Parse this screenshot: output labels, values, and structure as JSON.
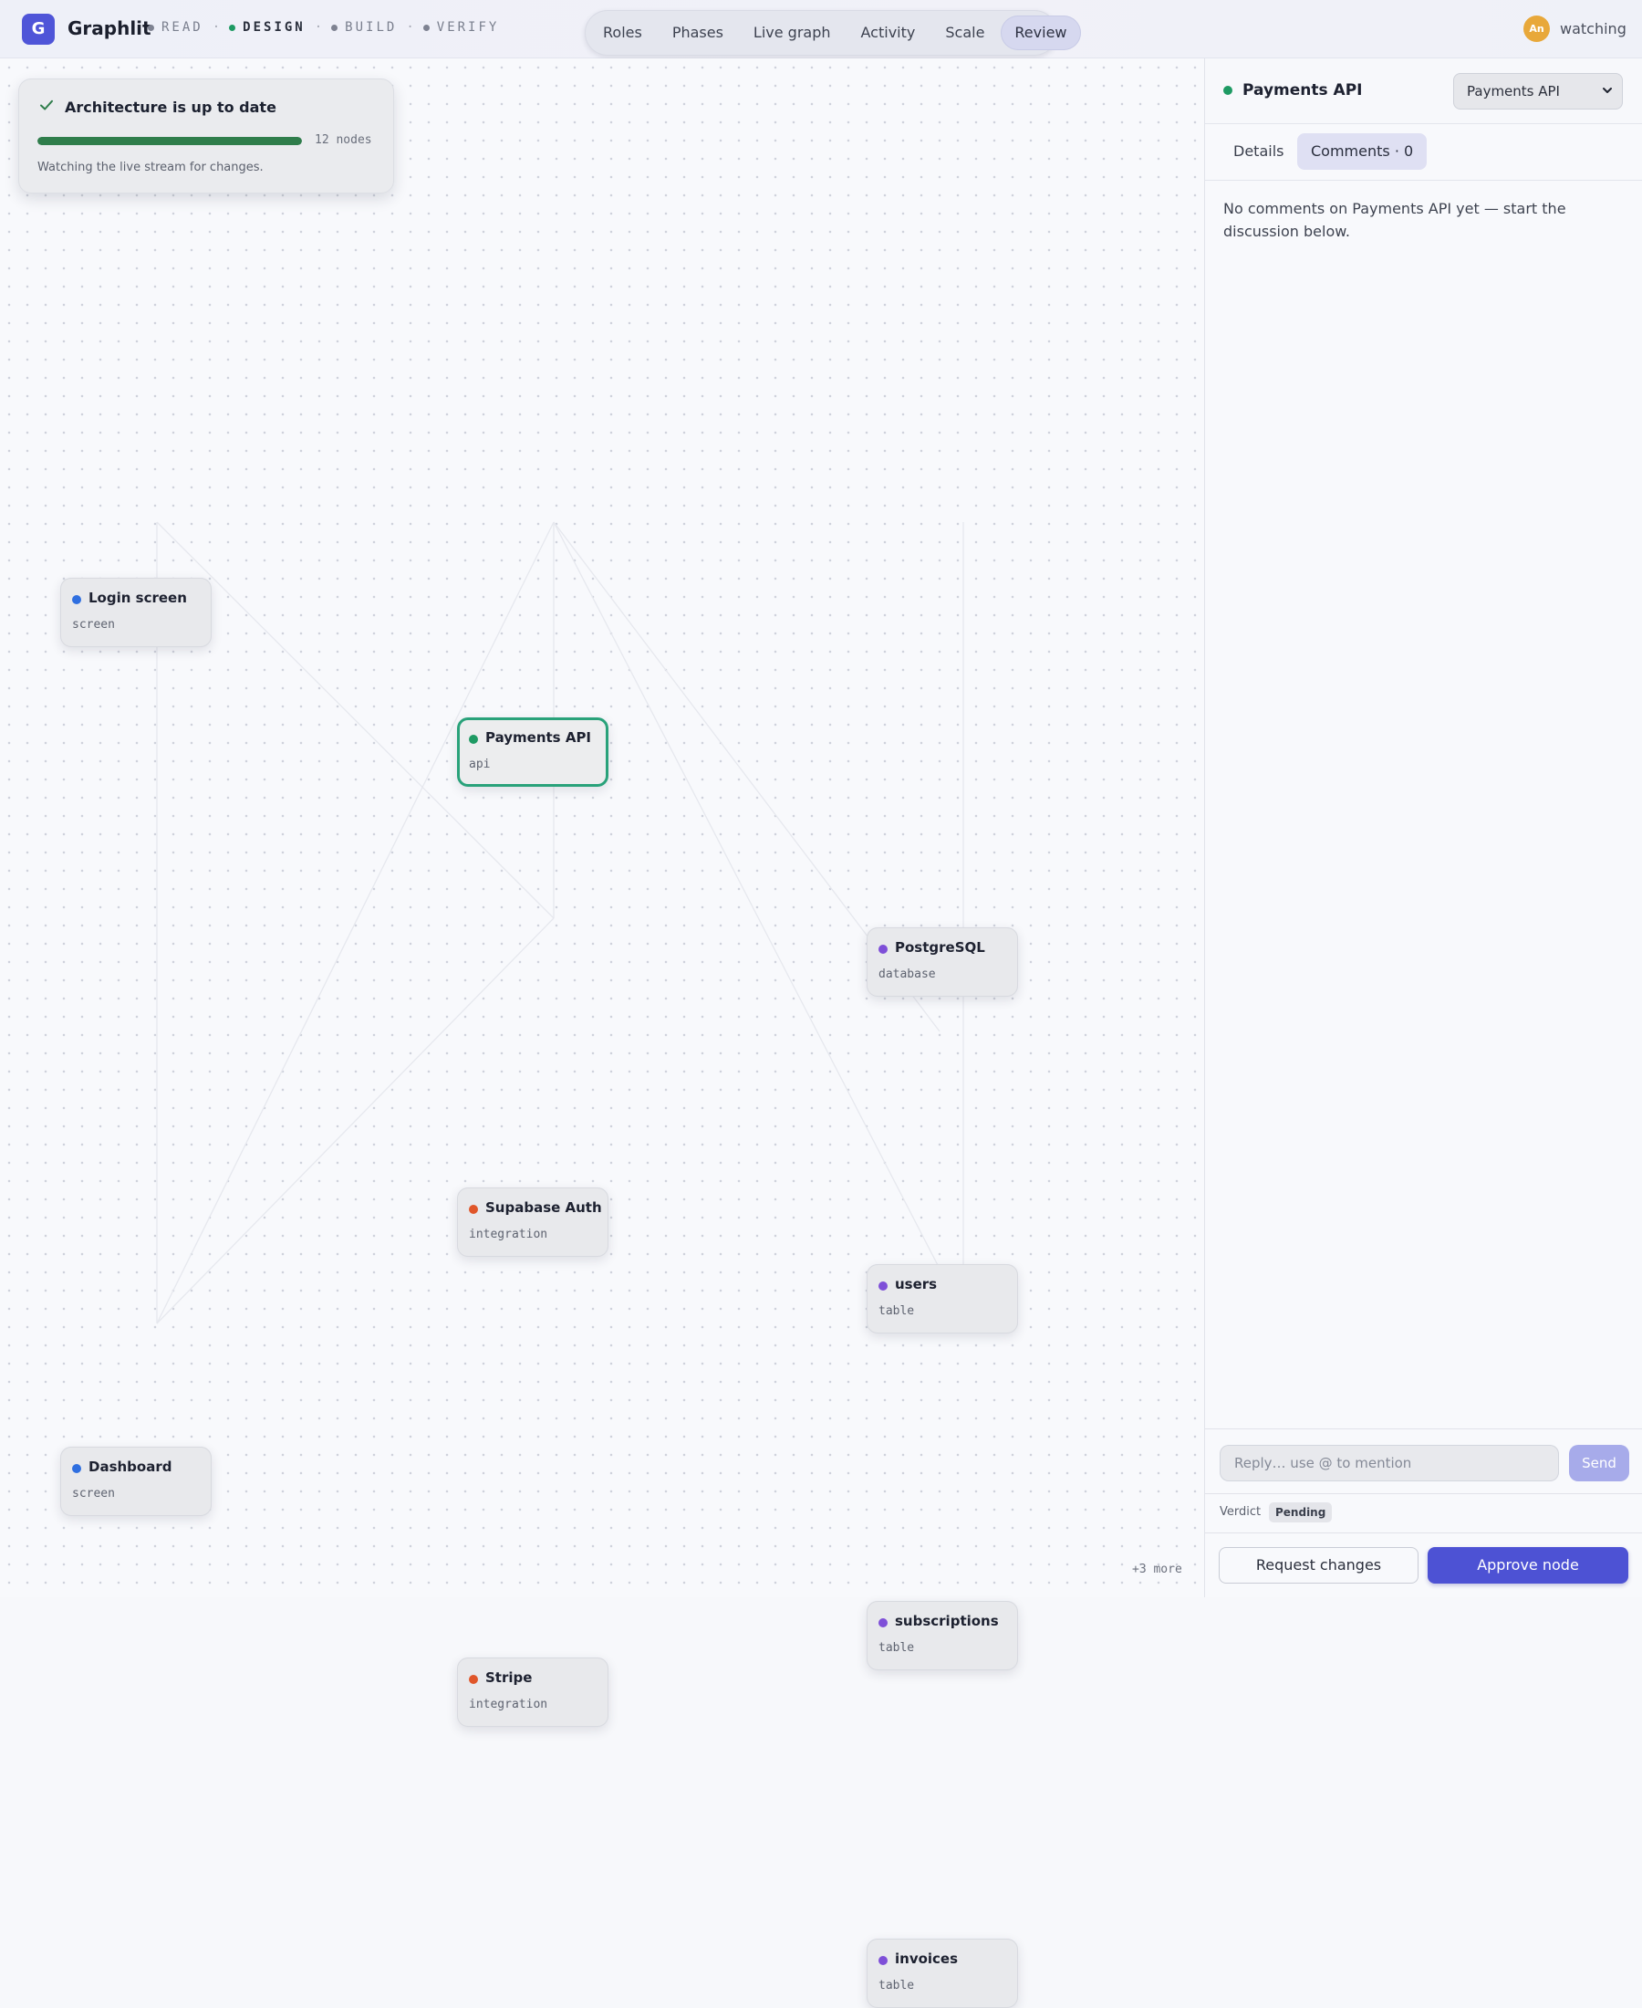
{
  "app": {
    "logo_letter": "G",
    "name": "Graphlit",
    "brand_color": "#4f55d8"
  },
  "phases": [
    {
      "label": "READ",
      "active": false
    },
    {
      "label": "DESIGN",
      "active": true
    },
    {
      "label": "BUILD",
      "active": false
    },
    {
      "label": "VERIFY",
      "active": false
    }
  ],
  "nav": {
    "items": [
      "Roles",
      "Phases",
      "Live graph",
      "Activity",
      "Scale",
      "Review"
    ],
    "active": "Review"
  },
  "presence": {
    "initials": "An",
    "status": "watching"
  },
  "status_card": {
    "title": "Architecture is up to date",
    "progress": 1.0,
    "node_count": "12 nodes",
    "subtitle": "Watching the live stream for changes."
  },
  "nodes": [
    {
      "id": "login",
      "title": "Login screen",
      "type": "screen",
      "color": "#2f6fe0",
      "selected": false
    },
    {
      "id": "payments",
      "title": "Payments API",
      "type": "api",
      "color": "#1e9a63",
      "selected": true
    },
    {
      "id": "postgres",
      "title": "PostgreSQL",
      "type": "database",
      "color": "#7e4fd8",
      "selected": false
    },
    {
      "id": "supabase",
      "title": "Supabase Auth",
      "type": "integration",
      "color": "#e0562a",
      "selected": false
    },
    {
      "id": "users",
      "title": "users",
      "type": "table",
      "color": "#7e4fd8",
      "selected": false
    },
    {
      "id": "dashboard",
      "title": "Dashboard",
      "type": "screen",
      "color": "#2f6fe0",
      "selected": false
    },
    {
      "id": "subscriptions",
      "title": "subscriptions",
      "type": "table",
      "color": "#7e4fd8",
      "selected": false
    },
    {
      "id": "stripe",
      "title": "Stripe",
      "type": "integration",
      "color": "#e0562a",
      "selected": false
    },
    {
      "id": "invoices",
      "title": "invoices",
      "type": "table",
      "color": "#7e4fd8",
      "selected": false
    }
  ],
  "more_nodes_label": "+3 more",
  "panel": {
    "title": "Payments API",
    "status_color": "#1e9a63",
    "selector_value": "Payments API",
    "tabs": [
      "Details",
      "Comments · 0"
    ],
    "active_tab": "Comments · 0",
    "empty_message": "No comments on Payments API yet — start the discussion below.",
    "reply_placeholder": "Reply… use @ to mention",
    "send_label": "Send",
    "verdict_label": "Verdict",
    "verdict_value": "Pending",
    "request_changes_label": "Request changes",
    "approve_label": "Approve node"
  }
}
